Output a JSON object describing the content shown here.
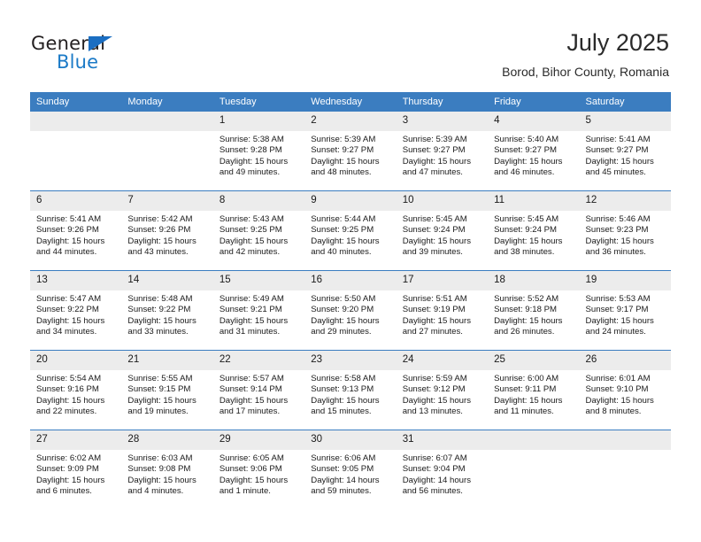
{
  "brand": {
    "name_top": "General",
    "name_bottom": "Blue",
    "triangle_icon": "blue-triangle-icon",
    "color_dark": "#231f20",
    "color_blue": "#1b7ac7"
  },
  "header": {
    "title": "July 2025",
    "subtitle": "Borod, Bihor County, Romania"
  },
  "theme": {
    "header_bar": "#3b7dc0",
    "daynum_band": "#ececec",
    "text": "#1a1a1a"
  },
  "calendar": {
    "weekday_headers": [
      "Sunday",
      "Monday",
      "Tuesday",
      "Wednesday",
      "Thursday",
      "Friday",
      "Saturday"
    ],
    "weeks": [
      [
        {
          "day": ""
        },
        {
          "day": ""
        },
        {
          "day": "1",
          "sunrise": "Sunrise: 5:38 AM",
          "sunset": "Sunset: 9:28 PM",
          "daylight_1": "Daylight: 15 hours",
          "daylight_2": "and 49 minutes."
        },
        {
          "day": "2",
          "sunrise": "Sunrise: 5:39 AM",
          "sunset": "Sunset: 9:27 PM",
          "daylight_1": "Daylight: 15 hours",
          "daylight_2": "and 48 minutes."
        },
        {
          "day": "3",
          "sunrise": "Sunrise: 5:39 AM",
          "sunset": "Sunset: 9:27 PM",
          "daylight_1": "Daylight: 15 hours",
          "daylight_2": "and 47 minutes."
        },
        {
          "day": "4",
          "sunrise": "Sunrise: 5:40 AM",
          "sunset": "Sunset: 9:27 PM",
          "daylight_1": "Daylight: 15 hours",
          "daylight_2": "and 46 minutes."
        },
        {
          "day": "5",
          "sunrise": "Sunrise: 5:41 AM",
          "sunset": "Sunset: 9:27 PM",
          "daylight_1": "Daylight: 15 hours",
          "daylight_2": "and 45 minutes."
        }
      ],
      [
        {
          "day": "6",
          "sunrise": "Sunrise: 5:41 AM",
          "sunset": "Sunset: 9:26 PM",
          "daylight_1": "Daylight: 15 hours",
          "daylight_2": "and 44 minutes."
        },
        {
          "day": "7",
          "sunrise": "Sunrise: 5:42 AM",
          "sunset": "Sunset: 9:26 PM",
          "daylight_1": "Daylight: 15 hours",
          "daylight_2": "and 43 minutes."
        },
        {
          "day": "8",
          "sunrise": "Sunrise: 5:43 AM",
          "sunset": "Sunset: 9:25 PM",
          "daylight_1": "Daylight: 15 hours",
          "daylight_2": "and 42 minutes."
        },
        {
          "day": "9",
          "sunrise": "Sunrise: 5:44 AM",
          "sunset": "Sunset: 9:25 PM",
          "daylight_1": "Daylight: 15 hours",
          "daylight_2": "and 40 minutes."
        },
        {
          "day": "10",
          "sunrise": "Sunrise: 5:45 AM",
          "sunset": "Sunset: 9:24 PM",
          "daylight_1": "Daylight: 15 hours",
          "daylight_2": "and 39 minutes."
        },
        {
          "day": "11",
          "sunrise": "Sunrise: 5:45 AM",
          "sunset": "Sunset: 9:24 PM",
          "daylight_1": "Daylight: 15 hours",
          "daylight_2": "and 38 minutes."
        },
        {
          "day": "12",
          "sunrise": "Sunrise: 5:46 AM",
          "sunset": "Sunset: 9:23 PM",
          "daylight_1": "Daylight: 15 hours",
          "daylight_2": "and 36 minutes."
        }
      ],
      [
        {
          "day": "13",
          "sunrise": "Sunrise: 5:47 AM",
          "sunset": "Sunset: 9:22 PM",
          "daylight_1": "Daylight: 15 hours",
          "daylight_2": "and 34 minutes."
        },
        {
          "day": "14",
          "sunrise": "Sunrise: 5:48 AM",
          "sunset": "Sunset: 9:22 PM",
          "daylight_1": "Daylight: 15 hours",
          "daylight_2": "and 33 minutes."
        },
        {
          "day": "15",
          "sunrise": "Sunrise: 5:49 AM",
          "sunset": "Sunset: 9:21 PM",
          "daylight_1": "Daylight: 15 hours",
          "daylight_2": "and 31 minutes."
        },
        {
          "day": "16",
          "sunrise": "Sunrise: 5:50 AM",
          "sunset": "Sunset: 9:20 PM",
          "daylight_1": "Daylight: 15 hours",
          "daylight_2": "and 29 minutes."
        },
        {
          "day": "17",
          "sunrise": "Sunrise: 5:51 AM",
          "sunset": "Sunset: 9:19 PM",
          "daylight_1": "Daylight: 15 hours",
          "daylight_2": "and 27 minutes."
        },
        {
          "day": "18",
          "sunrise": "Sunrise: 5:52 AM",
          "sunset": "Sunset: 9:18 PM",
          "daylight_1": "Daylight: 15 hours",
          "daylight_2": "and 26 minutes."
        },
        {
          "day": "19",
          "sunrise": "Sunrise: 5:53 AM",
          "sunset": "Sunset: 9:17 PM",
          "daylight_1": "Daylight: 15 hours",
          "daylight_2": "and 24 minutes."
        }
      ],
      [
        {
          "day": "20",
          "sunrise": "Sunrise: 5:54 AM",
          "sunset": "Sunset: 9:16 PM",
          "daylight_1": "Daylight: 15 hours",
          "daylight_2": "and 22 minutes."
        },
        {
          "day": "21",
          "sunrise": "Sunrise: 5:55 AM",
          "sunset": "Sunset: 9:15 PM",
          "daylight_1": "Daylight: 15 hours",
          "daylight_2": "and 19 minutes."
        },
        {
          "day": "22",
          "sunrise": "Sunrise: 5:57 AM",
          "sunset": "Sunset: 9:14 PM",
          "daylight_1": "Daylight: 15 hours",
          "daylight_2": "and 17 minutes."
        },
        {
          "day": "23",
          "sunrise": "Sunrise: 5:58 AM",
          "sunset": "Sunset: 9:13 PM",
          "daylight_1": "Daylight: 15 hours",
          "daylight_2": "and 15 minutes."
        },
        {
          "day": "24",
          "sunrise": "Sunrise: 5:59 AM",
          "sunset": "Sunset: 9:12 PM",
          "daylight_1": "Daylight: 15 hours",
          "daylight_2": "and 13 minutes."
        },
        {
          "day": "25",
          "sunrise": "Sunrise: 6:00 AM",
          "sunset": "Sunset: 9:11 PM",
          "daylight_1": "Daylight: 15 hours",
          "daylight_2": "and 11 minutes."
        },
        {
          "day": "26",
          "sunrise": "Sunrise: 6:01 AM",
          "sunset": "Sunset: 9:10 PM",
          "daylight_1": "Daylight: 15 hours",
          "daylight_2": "and 8 minutes."
        }
      ],
      [
        {
          "day": "27",
          "sunrise": "Sunrise: 6:02 AM",
          "sunset": "Sunset: 9:09 PM",
          "daylight_1": "Daylight: 15 hours",
          "daylight_2": "and 6 minutes."
        },
        {
          "day": "28",
          "sunrise": "Sunrise: 6:03 AM",
          "sunset": "Sunset: 9:08 PM",
          "daylight_1": "Daylight: 15 hours",
          "daylight_2": "and 4 minutes."
        },
        {
          "day": "29",
          "sunrise": "Sunrise: 6:05 AM",
          "sunset": "Sunset: 9:06 PM",
          "daylight_1": "Daylight: 15 hours",
          "daylight_2": "and 1 minute."
        },
        {
          "day": "30",
          "sunrise": "Sunrise: 6:06 AM",
          "sunset": "Sunset: 9:05 PM",
          "daylight_1": "Daylight: 14 hours",
          "daylight_2": "and 59 minutes."
        },
        {
          "day": "31",
          "sunrise": "Sunrise: 6:07 AM",
          "sunset": "Sunset: 9:04 PM",
          "daylight_1": "Daylight: 14 hours",
          "daylight_2": "and 56 minutes."
        },
        {
          "day": ""
        },
        {
          "day": ""
        }
      ]
    ]
  }
}
